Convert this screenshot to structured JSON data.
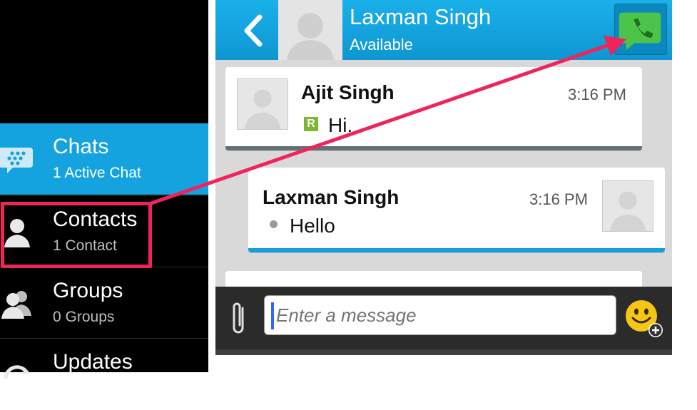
{
  "nav": {
    "items": [
      {
        "label": "Chats",
        "sub": "1 Active Chat"
      },
      {
        "label": "Contacts",
        "sub": "1 Contact"
      },
      {
        "label": "Groups",
        "sub": "0 Groups"
      },
      {
        "label": "Updates",
        "sub": ""
      }
    ]
  },
  "header": {
    "name": "Laxman Singh",
    "status": "Available"
  },
  "messages": [
    {
      "sender": "Ajit Singh",
      "time": "3:16 PM",
      "badge": "R",
      "text": "Hi."
    },
    {
      "sender": "Laxman Singh",
      "time": "3:16 PM",
      "text": "Hello"
    }
  ],
  "composer": {
    "placeholder": "Enter a message"
  },
  "colors": {
    "accent": "#15a3df",
    "annotation": "#f0245d",
    "call_green": "#4cc44a",
    "badge_green": "#7cb82f"
  }
}
